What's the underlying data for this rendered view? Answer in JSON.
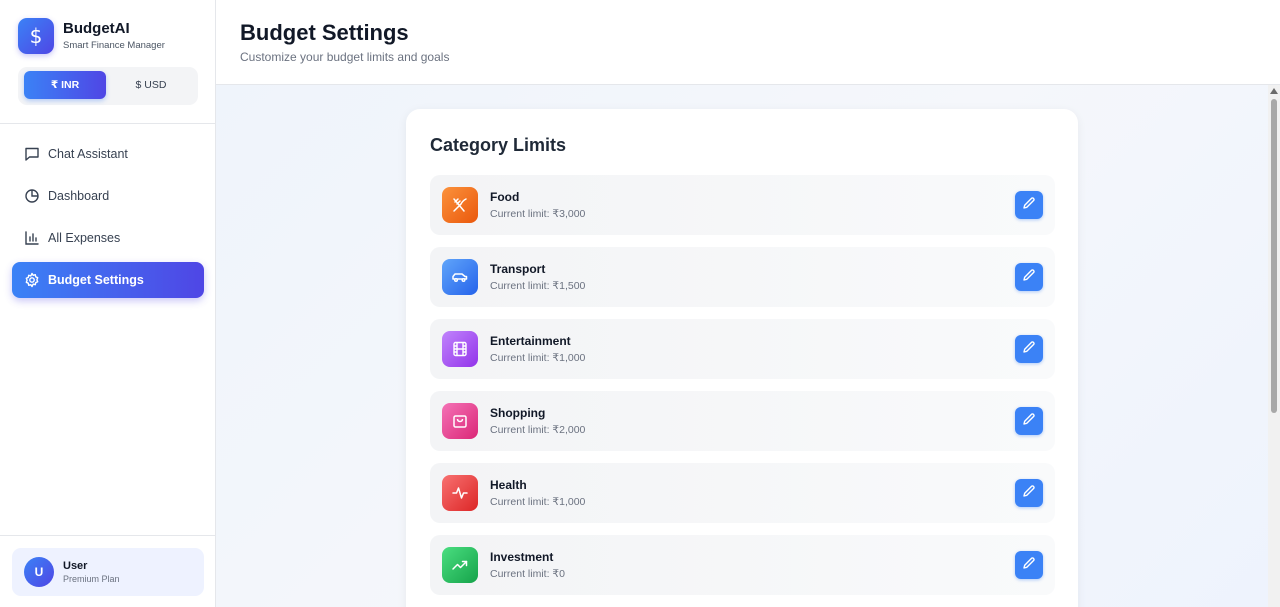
{
  "brand": {
    "name": "BudgetAI",
    "subtitle": "Smart Finance Manager"
  },
  "currency": {
    "options": [
      "₹ INR",
      "$ USD"
    ],
    "selected": "₹ INR"
  },
  "nav": {
    "items": [
      {
        "label": "Chat Assistant",
        "icon": "chat-icon",
        "active": false
      },
      {
        "label": "Dashboard",
        "icon": "pie-chart-icon",
        "active": false
      },
      {
        "label": "All Expenses",
        "icon": "bar-chart-icon",
        "active": false
      },
      {
        "label": "Budget Settings",
        "icon": "gear-icon",
        "active": true
      }
    ]
  },
  "user": {
    "initial": "U",
    "name": "User",
    "plan": "Premium Plan"
  },
  "header": {
    "title": "Budget Settings",
    "subtitle": "Customize your budget limits and goals"
  },
  "card": {
    "title": "Category Limits"
  },
  "categories": [
    {
      "name": "Food",
      "limit": "Current limit: ₹3,000",
      "icon": "utensils-icon",
      "color_from": "#f97316",
      "color_to": "#ea580c"
    },
    {
      "name": "Transport",
      "limit": "Current limit: ₹1,500",
      "icon": "car-icon",
      "color_from": "#60a5fa",
      "color_to": "#2563eb"
    },
    {
      "name": "Entertainment",
      "limit": "Current limit: ₹1,000",
      "icon": "film-icon",
      "color_from": "#c084fc",
      "color_to": "#9333ea"
    },
    {
      "name": "Shopping",
      "limit": "Current limit: ₹2,000",
      "icon": "shopping-bag-icon",
      "color_from": "#f472b6",
      "color_to": "#db2777"
    },
    {
      "name": "Health",
      "limit": "Current limit: ₹1,000",
      "icon": "heartbeat-icon",
      "color_from": "#f87171",
      "color_to": "#dc2626"
    },
    {
      "name": "Investment",
      "limit": "Current limit: ₹0",
      "icon": "trending-up-icon",
      "color_from": "#4ade80",
      "color_to": "#16a34a"
    }
  ],
  "colors": {
    "accent": "#3b82f6",
    "accent_dark": "#4f46e5"
  }
}
